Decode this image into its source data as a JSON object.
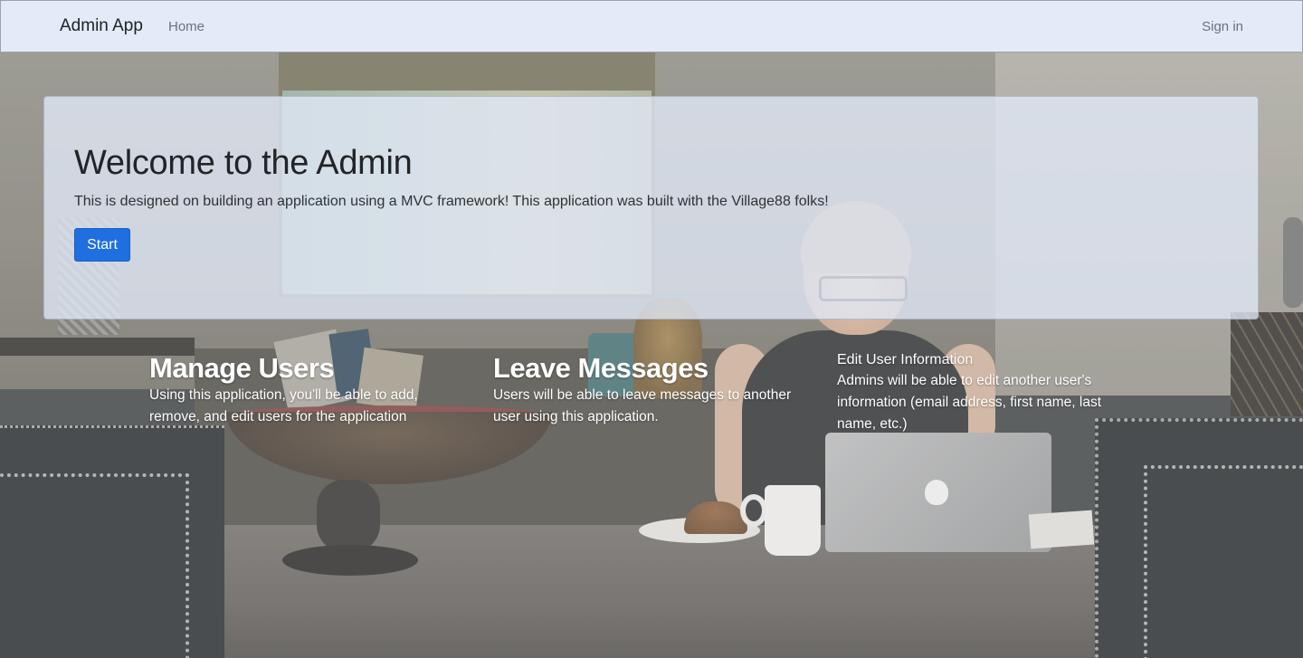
{
  "navbar": {
    "brand": "Admin App",
    "home_link": "Home",
    "signin_link": "Sign in"
  },
  "jumbotron": {
    "title": "Welcome to the Admin",
    "description": "This is designed on building an application using a MVC framework! This application was built with the Village88 folks!",
    "start_button": "Start",
    "button_color": "#1f6fe0"
  },
  "features": [
    {
      "title": "Manage Users",
      "description": "Using this application, you'll be able to add, remove, and edit users for the application"
    },
    {
      "title": "Leave Messages",
      "description": "Users will be able to leave messages to another user using this application."
    },
    {
      "title": "Edit User Information",
      "description": "Admins will be able to edit another user's information (email address, first name, last name, etc.)"
    }
  ],
  "colors": {
    "navbar_bg": "#e3ebf9",
    "accent": "#1f6fe0"
  },
  "background_image": "office-desk-photo"
}
